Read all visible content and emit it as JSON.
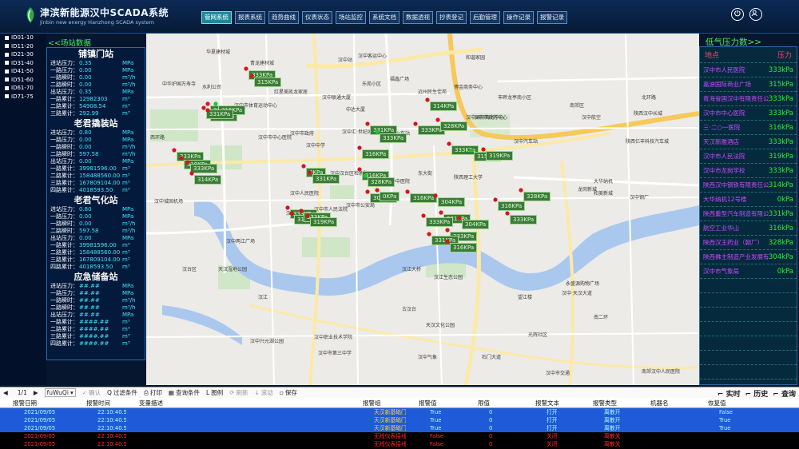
{
  "header": {
    "title": "津滨新能源汉中SCADA系统",
    "subtitle": "Jinbin new energy Hanzhong SCADA system",
    "nav": [
      "管网系统",
      "报表系统",
      "趋势曲线",
      "仪表状态",
      "场站监控",
      "系统文档",
      "数据透视",
      "抄表登记",
      "后勤管理",
      "操作记录",
      "报警记录"
    ],
    "active_nav": 0,
    "power_icon": "power-icon",
    "user_icon": "user-icon"
  },
  "id_list": [
    "ID01-10",
    "ID11-20",
    "ID21-30",
    "ID31-40",
    "ID41-50",
    "ID51-60",
    "ID61-70",
    "ID71-75"
  ],
  "stations": {
    "title": "<<场站数据",
    "units": [
      "MPa",
      "MPa",
      "m³/h",
      "m³/h",
      "MPa",
      "m³",
      "m³",
      "m³"
    ],
    "list": [
      {
        "name": "铺镇门站",
        "rows": [
          {
            "label": "进站压力：",
            "value": "0.35",
            "unit": "MPa"
          },
          {
            "label": "一路压力：",
            "value": "0.00",
            "unit": "MPa"
          },
          {
            "label": "一路瞬时：",
            "value": "0.00",
            "unit": "m³/h"
          },
          {
            "label": "二路瞬时：",
            "value": "0.00",
            "unit": "m³/h"
          },
          {
            "label": "出站压力：",
            "value": "0.35",
            "unit": "MPa"
          },
          {
            "label": "一路累计：",
            "value": "12982303",
            "unit": "m³"
          },
          {
            "label": "二路累计：",
            "value": "54908.54",
            "unit": "m³"
          },
          {
            "label": "三路累计：",
            "value": "292.99",
            "unit": "m³"
          }
        ]
      },
      {
        "name": "老君撬装站",
        "rows": [
          {
            "label": "进站压力：",
            "value": "0.80",
            "unit": "MPa"
          },
          {
            "label": "一路压力：",
            "value": "0.00",
            "unit": "MPa"
          },
          {
            "label": "一路瞬时：",
            "value": "0.00",
            "unit": "m³/h"
          },
          {
            "label": "二路瞬时：",
            "value": "597.58",
            "unit": "m³/h"
          },
          {
            "label": "出站压力：",
            "value": "0.00",
            "unit": "MPa"
          },
          {
            "label": "一路累计：",
            "value": "39981596.00",
            "unit": "m³"
          },
          {
            "label": "二路累计：",
            "value": "158488560.00",
            "unit": "m³"
          },
          {
            "label": "三路累计：",
            "value": "167809104.00",
            "unit": "m³"
          },
          {
            "label": "四路累计：",
            "value": "4018593.50",
            "unit": "m³"
          }
        ]
      },
      {
        "name": "老君气化站",
        "rows": [
          {
            "label": "进站压力：",
            "value": "0.80",
            "unit": "MPa"
          },
          {
            "label": "一路压力：",
            "value": "0.00",
            "unit": "MPa"
          },
          {
            "label": "一路瞬时：",
            "value": "0.00",
            "unit": "m³/h"
          },
          {
            "label": "二路瞬时：",
            "value": "597.58",
            "unit": "m³/h"
          },
          {
            "label": "出站压力：",
            "value": "0.00",
            "unit": "MPa"
          },
          {
            "label": "一路累计：",
            "value": "39981596.00",
            "unit": "m³"
          },
          {
            "label": "二路累计：",
            "value": "158488560.00",
            "unit": "m³"
          },
          {
            "label": "三路累计：",
            "value": "167809104.00",
            "unit": "m³"
          },
          {
            "label": "四路累计：",
            "value": "4018593.50",
            "unit": "m³"
          }
        ]
      },
      {
        "name": "应急储备站",
        "rows": [
          {
            "label": "进站压力：",
            "value": "##.##",
            "unit": "MPa"
          },
          {
            "label": "一路压力：",
            "value": "##.##",
            "unit": "MPa"
          },
          {
            "label": "一路瞬时：",
            "value": "##.##",
            "unit": "m³/h"
          },
          {
            "label": "二路瞬时：",
            "value": "##.##",
            "unit": "m³/h"
          },
          {
            "label": "出站压力：",
            "value": "##.##",
            "unit": "MPa"
          },
          {
            "label": "一路累计：",
            "value": "####.##",
            "unit": "m³"
          },
          {
            "label": "二路累计：",
            "value": "####.##",
            "unit": "m³"
          },
          {
            "label": "三路累计：",
            "value": "####.##",
            "unit": "m³"
          },
          {
            "label": "四路累计：",
            "value": "####.##",
            "unit": "m³"
          }
        ]
      }
    ]
  },
  "pressure": {
    "title": "低气压力数>>",
    "col_location": "地点",
    "col_pressure": "压力",
    "rows": [
      {
        "location": "汉中市人民医院",
        "value": "333kPa"
      },
      {
        "location": "嘉迪国际商业广场",
        "value": "315kPa"
      },
      {
        "location": "青海省国汉中有限责任公司",
        "value": "333kPa"
      },
      {
        "location": "汉中市中心医院",
        "value": "333kPa"
      },
      {
        "location": "三·二○一医院",
        "value": "316kPa"
      },
      {
        "location": "天汉新雅酒店",
        "value": "333kPa"
      },
      {
        "location": "汉中市人民法院",
        "value": "319kPa"
      },
      {
        "location": "汉中市龙岗学校",
        "value": "333kPa"
      },
      {
        "location": "陕西汉中钢铁有限责任公司",
        "value": "314kPa"
      },
      {
        "location": "大华纳机12号楼",
        "value": "0kPa"
      },
      {
        "location": "陕西重型汽车制造有限公司",
        "value": "331kPa"
      },
      {
        "location": "航空工业华山",
        "value": "316kPa"
      },
      {
        "location": "陕西汉王药业（朝厂）",
        "value": "328kPa"
      },
      {
        "location": "陕西佛主制造产业发展有限公司",
        "value": "304kPa"
      },
      {
        "location": "汉中市气象局",
        "value": "0kPa"
      }
    ],
    "empty_rows": 7
  },
  "map": {
    "tags": [
      "333KPa",
      "315KPa",
      "333KPa",
      "333KPa",
      "316KPa",
      "331KPa",
      "333KPa",
      "319KPa",
      "333KPa",
      "314KPa",
      "0KPa",
      "331KPa",
      "316KPa",
      "328KPa",
      "304KPa",
      "0KPa",
      "333KPa",
      "315KPa",
      "333KPa",
      "319KPa",
      "316KPa",
      "331KPa",
      "333KPa",
      "333KPa",
      "314KPa",
      "328KPa",
      "333KPa",
      "316KPa",
      "304KPa",
      "331KPa",
      "333KPa",
      "315KPa",
      "319KPa",
      "316KPa",
      "333KPa",
      "328KPa",
      "333KPa",
      "331KPa",
      "316KPa",
      "304KPa"
    ],
    "pois": [
      "华夏建材城",
      "青龙建材城",
      "汉中站",
      "汉中客运中心",
      "和谐家园",
      "中华护国万寿寺",
      "水利公司",
      "乐苑小区",
      "福鑫广场",
      "博金商务中心",
      "中达大厦",
      "汉中市体育运动中心",
      "红星美凯龙家居",
      "汉中联通大厦",
      "远州民生佳苑",
      "丰畔龙亭南小区",
      "汉中市中心医院",
      "汉中市政府",
      "汉中汇·世纪城",
      "汉中国际商务中心",
      "汉中人民医院",
      "汉江体育馆",
      "陕西理工大学",
      "陕西亿丰科技汽车城",
      "汉江生态公园",
      "天汉湿地公园",
      "汉中汽车站",
      "汉中市政务中心",
      "汉中中学",
      "天汉文化公园",
      "古汉台",
      "汉江",
      "望江楼",
      "汉中汉台区检察院",
      "汉中市公安局",
      "陕西汉中长城",
      "南郊区",
      "大华纳机",
      "龙岗新城",
      "汉中火车站",
      "汉中兴元湖公园",
      "汉中市第三中学",
      "汉台区",
      "汉中两江广场",
      "石门大道",
      "汉中市交通",
      "汉中职业技术学院",
      "汉中气象",
      "汉中中医院",
      "汉中城固机场",
      "汉江大桥",
      "东大街",
      "北环路",
      "西环路",
      "南二环",
      "汉中航空",
      "汉中钢厂",
      "汉中·天汉大道",
      "和美新城",
      "永盛源购物广场",
      "汉中市人民法院",
      "光辉社区",
      "南郊汉中人民医院"
    ]
  },
  "toolbar": {
    "page": "1/1",
    "user": "fuWuQi",
    "confirm": "确认",
    "filter": "过滤条件",
    "print": "打印",
    "query": "查询条件",
    "legend": "图例",
    "refresh": "刷新",
    "scroll": "滚动",
    "save": "保存",
    "realtime": "实时",
    "history": "历史",
    "search": "查询"
  },
  "alarm": {
    "columns": [
      "报警日期",
      "报警时间",
      "变量描述",
      "报警组",
      "报警值",
      "限值",
      "报警文本",
      "报警类型",
      "机器名",
      "恢复值"
    ],
    "rows": [
      {
        "date": "2021/09/05",
        "time": "22:10:40.551",
        "desc": "",
        "group": "天汉新基础门站",
        "value": "True",
        "limit": "0",
        "text": "打开",
        "type": "离散开",
        "machine": "",
        "restore": "False",
        "selected": true
      },
      {
        "date": "2021/09/05",
        "time": "22:10:40.551",
        "desc": "",
        "group": "天汉新基础门站",
        "value": "True",
        "limit": "0",
        "text": "打开",
        "type": "离散开",
        "machine": "",
        "restore": "True",
        "selected": true
      },
      {
        "date": "2021/09/05",
        "time": "22:10:40.551",
        "desc": "",
        "group": "天汉新基础门站",
        "value": "True",
        "limit": "0",
        "text": "打开",
        "type": "离散开",
        "machine": "",
        "restore": "True",
        "selected": true
      },
      {
        "date": "2021/09/05",
        "time": "22:10:40.551",
        "desc": "",
        "group": "无线仪表接线",
        "value": "False",
        "limit": "0",
        "text": "关闭",
        "type": "离散关",
        "machine": "",
        "restore": "",
        "selected": false
      },
      {
        "date": "2021/09/05",
        "time": "22:10:40.551",
        "desc": "",
        "group": "无线仪表接线",
        "value": "False",
        "limit": "0",
        "text": "关闭",
        "type": "离散关",
        "machine": "",
        "restore": "",
        "selected": false
      },
      {
        "date": "2021/09/05",
        "time": "22:10:40.551",
        "desc": "",
        "group": "无线仪表接线",
        "value": "False",
        "limit": "0",
        "text": "关闭",
        "type": "离散关",
        "machine": "",
        "restore": "",
        "selected": false
      }
    ]
  },
  "colors": {
    "accent": "#1a8a9a",
    "value": "#3de4ff",
    "pressure_loc": "#c84cff",
    "pressure_val": "#2cf02c",
    "title_green": "#49f05a",
    "alarm_red": "#ff2a2a",
    "alarm_sel": "#1f5ad8"
  }
}
